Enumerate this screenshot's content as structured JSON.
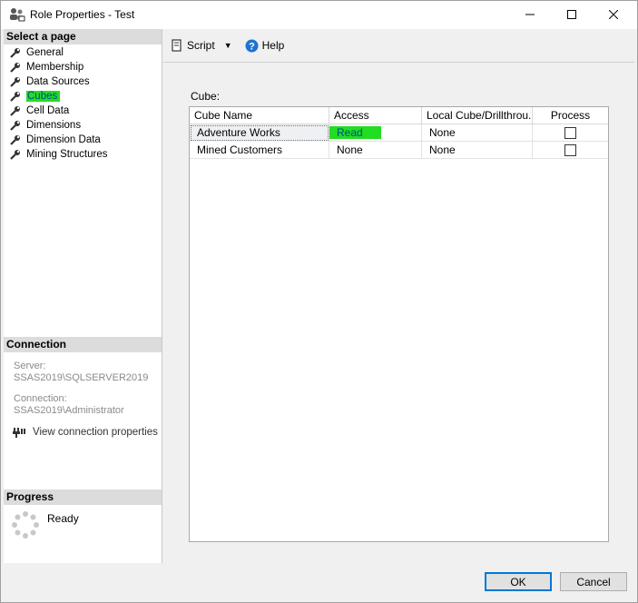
{
  "window": {
    "title": "Role Properties - Test",
    "controls": {
      "minimize": "—",
      "maximize": "☐",
      "close": "✕"
    }
  },
  "left_panel": {
    "select_page_header": "Select a page",
    "pages": [
      {
        "label": "General",
        "icon": "wrench-icon"
      },
      {
        "label": "Membership",
        "icon": "wrench-icon"
      },
      {
        "label": "Data Sources",
        "icon": "wrench-icon"
      },
      {
        "label": "Cubes",
        "icon": "wrench-icon",
        "selected": true
      },
      {
        "label": "Cell Data",
        "icon": "wrench-icon"
      },
      {
        "label": "Dimensions",
        "icon": "wrench-icon"
      },
      {
        "label": "Dimension Data",
        "icon": "wrench-icon"
      },
      {
        "label": "Mining Structures",
        "icon": "wrench-icon"
      }
    ],
    "connection": {
      "header": "Connection",
      "server_label": "Server:",
      "server_value": "SSAS2019\\SQLSERVER2019",
      "connection_label": "Connection:",
      "connection_value": "SSAS2019\\Administrator",
      "view_link": "View connection properties"
    },
    "progress": {
      "header": "Progress",
      "status": "Ready"
    }
  },
  "toolbar": {
    "script_label": "Script",
    "help_label": "Help"
  },
  "content": {
    "cube_label": "Cube:",
    "columns": [
      "Cube Name",
      "Access",
      "Local Cube/Drillthrou...",
      "Process"
    ],
    "rows": [
      {
        "cube_name": "Adventure Works",
        "access": "Read",
        "local": "None",
        "process": false
      },
      {
        "cube_name": "Mined Customers",
        "access": "None",
        "local": "None",
        "process": false
      }
    ]
  },
  "footer": {
    "ok_label": "OK",
    "cancel_label": "Cancel"
  },
  "colors": {
    "highlight": "#22dd22",
    "ok_border": "#0078d7",
    "section_header_bg": "#dcdcdc"
  }
}
